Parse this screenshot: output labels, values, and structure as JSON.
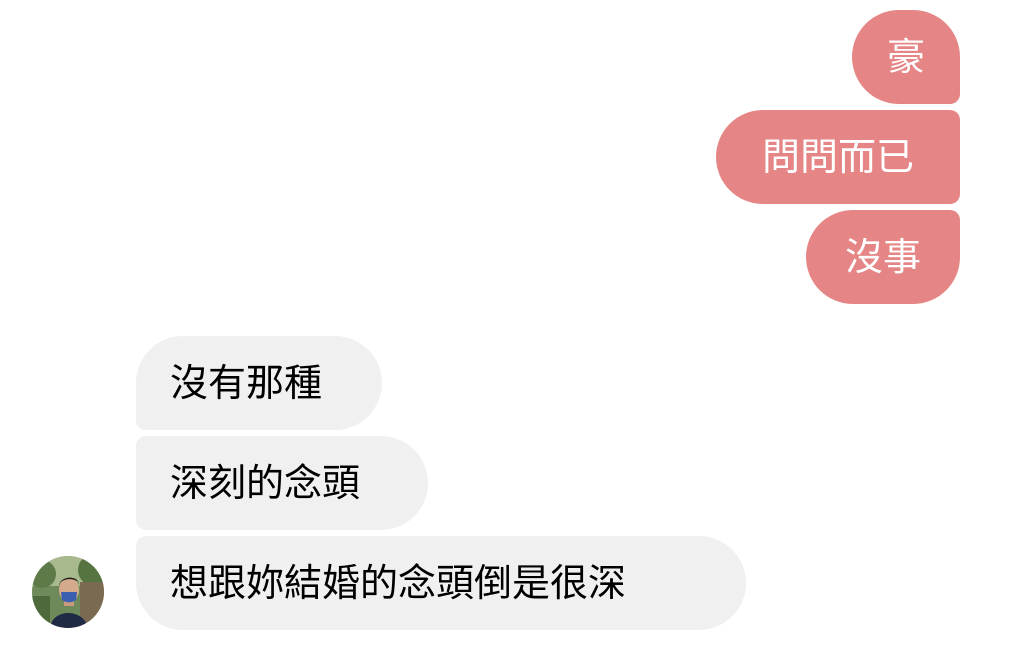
{
  "conversation": {
    "outgoing": [
      {
        "text": "豪"
      },
      {
        "text": "問問而已"
      },
      {
        "text": "沒事"
      }
    ],
    "incoming": [
      {
        "text": "沒有那種"
      },
      {
        "text": "深刻的念頭"
      },
      {
        "text": "想跟妳結婚的念頭倒是很深"
      }
    ]
  },
  "colors": {
    "outgoing_bubble": "#e58585",
    "incoming_bubble": "#f0f0f0",
    "outgoing_text": "#ffffff",
    "incoming_text": "#000000"
  },
  "avatar": {
    "icon": "user-avatar-photo"
  }
}
